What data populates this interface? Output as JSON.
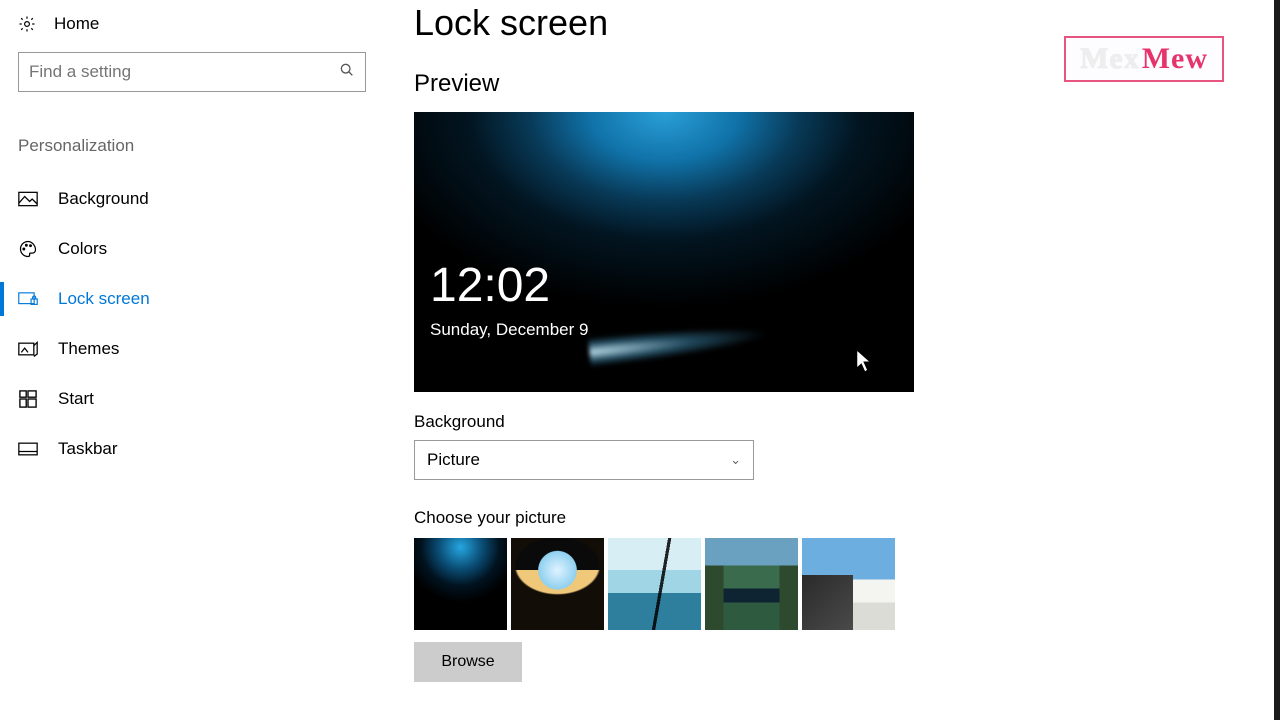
{
  "sidebar": {
    "home_label": "Home",
    "search_placeholder": "Find a setting",
    "category_label": "Personalization",
    "items": [
      {
        "label": "Background"
      },
      {
        "label": "Colors"
      },
      {
        "label": "Lock screen"
      },
      {
        "label": "Themes"
      },
      {
        "label": "Start"
      },
      {
        "label": "Taskbar"
      }
    ]
  },
  "main": {
    "title": "Lock screen",
    "preview_label": "Preview",
    "preview_time": "12:02",
    "preview_date": "Sunday, December 9",
    "background_label": "Background",
    "background_value": "Picture",
    "choose_label": "Choose your picture",
    "browse_label": "Browse"
  },
  "watermark": {
    "part1": "Mex",
    "part2": "Mew"
  }
}
